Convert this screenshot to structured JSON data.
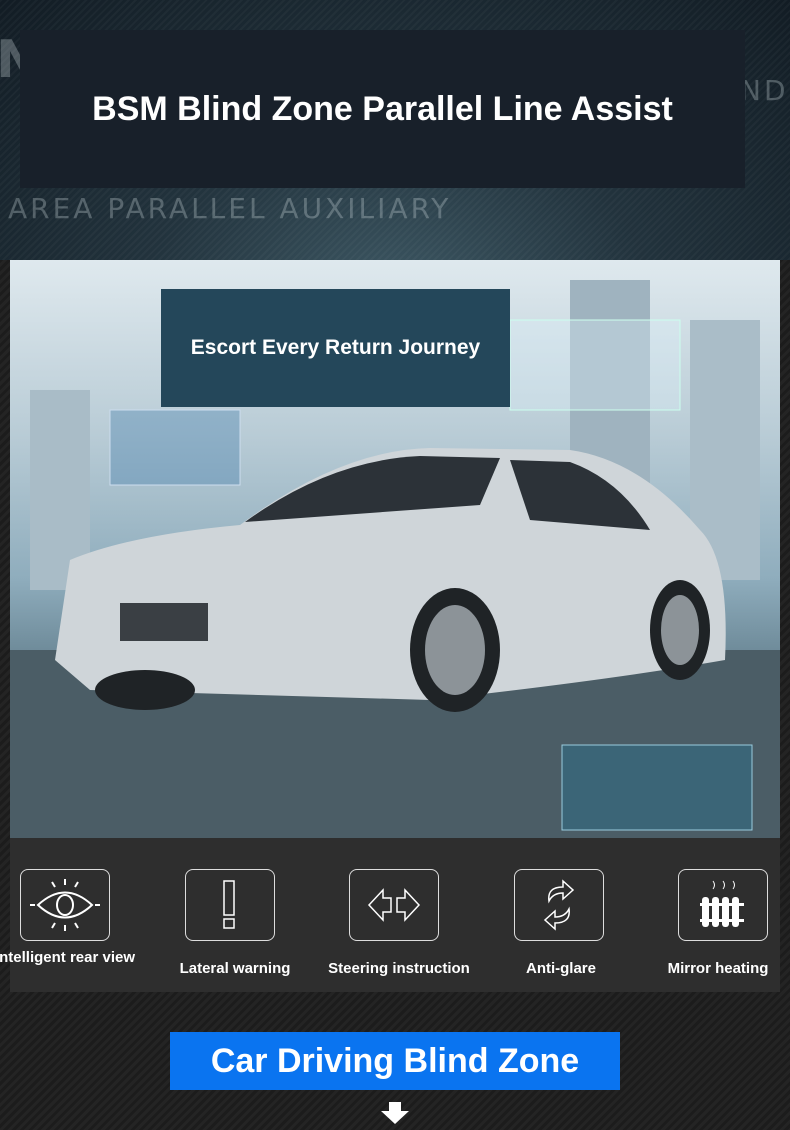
{
  "header": {
    "title": "BSM Blind Zone Parallel Line Assist",
    "bg_text_top_right": "ND",
    "bg_text_left": "N",
    "bg_subtitle": "AREA PARALLEL AUXILIARY"
  },
  "photo": {
    "caption": "Escort Every Return Journey"
  },
  "features": [
    {
      "label": "Intelligent rear view",
      "icon": "eye-icon"
    },
    {
      "label": "Lateral warning",
      "icon": "exclamation-icon"
    },
    {
      "label": "Steering instruction",
      "icon": "left-right-arrows-icon"
    },
    {
      "label": "Anti-glare",
      "icon": "refresh-arrows-icon"
    },
    {
      "label": "Mirror heating",
      "icon": "radiator-heat-icon"
    }
  ],
  "banner": {
    "label": "Car Driving Blind Zone",
    "color": "#0a74f0"
  }
}
